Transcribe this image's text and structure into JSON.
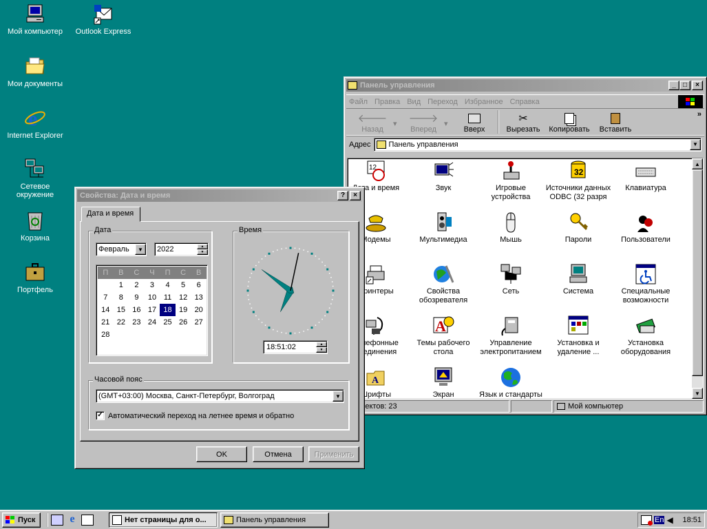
{
  "desktop": {
    "icons": [
      {
        "label": "Мой компьютер",
        "icon": "my-computer-icon"
      },
      {
        "label": "Outlook Express",
        "icon": "outlook-express-icon"
      },
      {
        "label": "Мои документы",
        "icon": "my-documents-icon"
      },
      {
        "label": "Internet Explorer",
        "icon": "internet-explorer-icon"
      },
      {
        "label": "Сетевое",
        "label2": "окружение",
        "icon": "network-icon"
      },
      {
        "label": "Корзина",
        "icon": "recycle-bin-icon"
      },
      {
        "label": "Портфель",
        "icon": "briefcase-icon"
      }
    ]
  },
  "control_panel": {
    "title": "Панель управления",
    "menu": [
      "Файл",
      "Правка",
      "Вид",
      "Переход",
      "Избранное",
      "Справка"
    ],
    "toolbar": {
      "back": "Назад",
      "forward": "Вперед",
      "up": "Вверх",
      "cut": "Вырезать",
      "copy": "Копировать",
      "paste": "Вставить"
    },
    "address_label": "Адрес",
    "address_value": "Панель управления",
    "items": [
      {
        "label": "Дата и время",
        "label2": ""
      },
      {
        "label": "Звук",
        "label2": ""
      },
      {
        "label": "Игровые",
        "label2": "устройства"
      },
      {
        "label": "Источники данных",
        "label2": "ODBC (32 разря"
      },
      {
        "label": "Клавиатура",
        "label2": ""
      },
      {
        "label": "Модемы",
        "label2": ""
      },
      {
        "label": "Мультимедиа",
        "label2": ""
      },
      {
        "label": "Мышь",
        "label2": ""
      },
      {
        "label": "Пароли",
        "label2": ""
      },
      {
        "label": "Пользователи",
        "label2": ""
      },
      {
        "label": "Принтеры",
        "label2": ""
      },
      {
        "label": "Свойства",
        "label2": "обозревателя"
      },
      {
        "label": "Сеть",
        "label2": ""
      },
      {
        "label": "Система",
        "label2": ""
      },
      {
        "label": "Специальные",
        "label2": "возможности"
      },
      {
        "label": "Телефонные",
        "label2": "соединения"
      },
      {
        "label": "Темы рабочего",
        "label2": "стола"
      },
      {
        "label": "Управление",
        "label2": "электропитанием"
      },
      {
        "label": "Установка и",
        "label2": "удаление ..."
      },
      {
        "label": "Установка",
        "label2": "оборудования"
      },
      {
        "label": "Шрифты",
        "label2": ""
      },
      {
        "label": "Экран",
        "label2": ""
      },
      {
        "label": "Язык и стандарты",
        "label2": ""
      }
    ],
    "status_count": "Объектов: 23",
    "status_location": "Мой компьютер"
  },
  "dialog": {
    "title": "Свойства: Дата и время",
    "help_btn": "?",
    "close_btn": "×",
    "tab": "Дата и время",
    "date_group": "Дата",
    "month": "Февраль",
    "year": "2022",
    "weekdays": [
      "П",
      "В",
      "С",
      "Ч",
      "П",
      "С",
      "В"
    ],
    "selected_day": 18,
    "time_group": "Время",
    "time_value": "18:51:02",
    "clock": {
      "hours": 18,
      "minutes": 51,
      "seconds": 2
    },
    "tz_group": "Часовой пояс",
    "tz_value": "(GMT+03:00) Москва, Санкт-Петербург, Волгоград",
    "dst_label": "Автоматический переход на летнее время и обратно",
    "dst_checked": true,
    "ok": "OK",
    "cancel": "Отмена",
    "apply": "Применить"
  },
  "taskbar": {
    "start": "Пуск",
    "tasks": [
      "Нет страницы для о...",
      "Панель управления"
    ],
    "lang": "En",
    "time": "18:51"
  }
}
